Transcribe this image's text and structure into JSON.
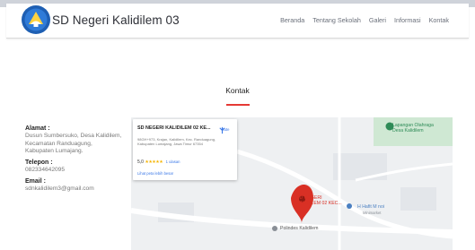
{
  "navbar": {
    "brand": "SD Negeri Kalidilem 03",
    "items": [
      "Beranda",
      "Tentang Sekolah",
      "Galeri",
      "Informasi",
      "Kontak"
    ]
  },
  "section": {
    "title": "Kontak"
  },
  "contact": {
    "address_label": "Alamat :",
    "address_lines": [
      "Dusun Sumbersuko, Desa Kalidilem,",
      "Kecamatan Randuagung,",
      "Kabupaten Lumajang."
    ],
    "phone_label": "Telepon :",
    "phone": "082334642095",
    "email_label": "Email :",
    "email": "sdnkalidilem3@gmail.com"
  },
  "map": {
    "card": {
      "name": "SD NEGERI KALIDILEM 02 KE...",
      "address": "98GH+973, Krajan, Kalidilem, Kec. Randuagung, Kabupaten Lumajang, Jawa Timur 67354",
      "rating": "5,0",
      "stars": "★★★★★",
      "reviews": "1 ulasan",
      "larger_map": "Lihat peta lebih besar",
      "route": "Rute"
    },
    "labels": {
      "school_line1": "SD NEGERI",
      "school_line2": "KALIDILEM 02 KEC...",
      "field_line1": "Lapangan Olahraga",
      "field_line2": "Desa Kalidilem",
      "hafit": "H Hafit M noi",
      "hafit_sub": "Minimarket",
      "polindes": "Polindes Kalidilem"
    }
  },
  "colors": {
    "accent": "#e53935",
    "link": "#3b78e7",
    "map_bg": "#eef0f2",
    "park": "#2e8b57"
  }
}
